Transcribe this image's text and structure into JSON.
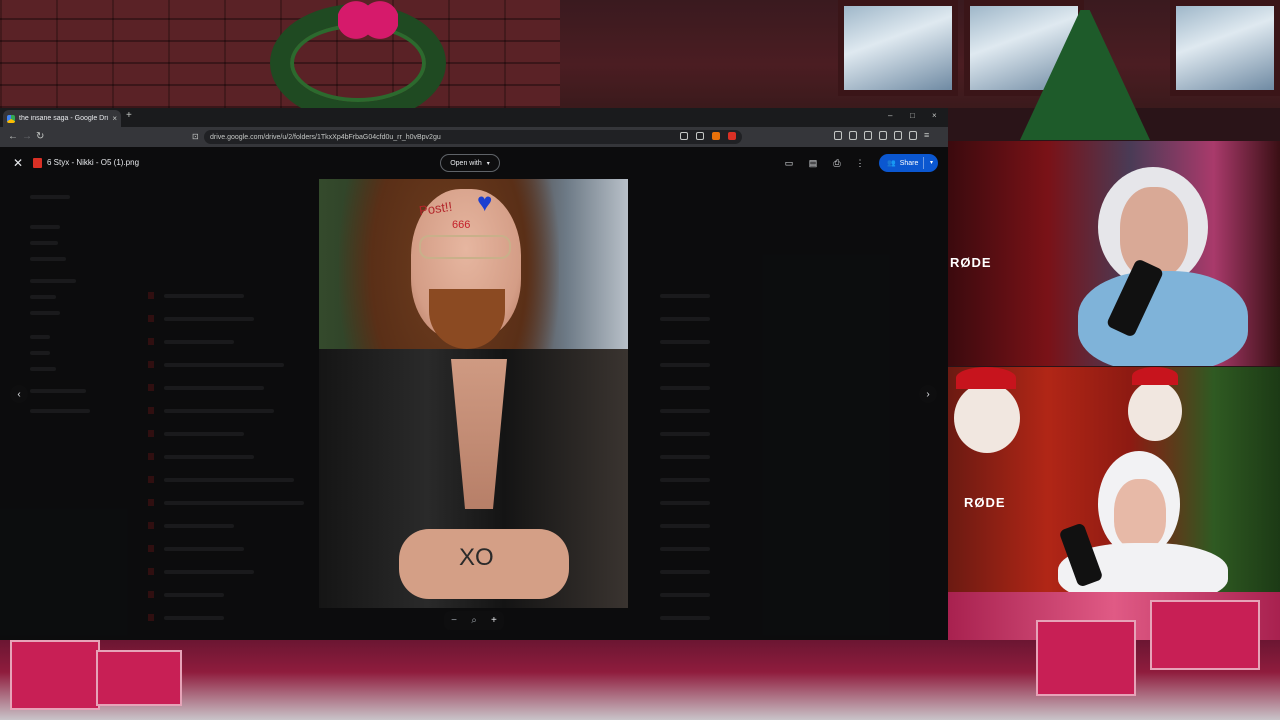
{
  "browser": {
    "tab_title": "the insane saga - Google Drive",
    "tab_close": "×",
    "new_tab": "+",
    "url": "drive.google.com/drive/u/2/folders/1TkxXp4bFrbaG04cfd0u_rr_h0vBpv2gu",
    "window_controls": {
      "minimize": "–",
      "maximize": "□",
      "close": "×"
    }
  },
  "viewer": {
    "close_glyph": "✕",
    "file_name": "6 Styx - Nikki - O5 (1).png",
    "open_with_label": "Open with",
    "caret": "▾",
    "share_label": "Share",
    "zoom_out": "−",
    "zoom_search": "⌕",
    "zoom_in": "+",
    "prev_glyph": "‹",
    "next_glyph": "›"
  },
  "photo": {
    "forehead_text": "Post!!",
    "forehead_number": "666",
    "hand_ink": "XO"
  },
  "webcams": {
    "mic_label_1": "RØDE",
    "mic_label_2": "RØDE"
  },
  "colors": {
    "share_button": "#0b57d0",
    "drive_bg": "#1b1c1e",
    "accent_pink": "#d61a6b"
  }
}
